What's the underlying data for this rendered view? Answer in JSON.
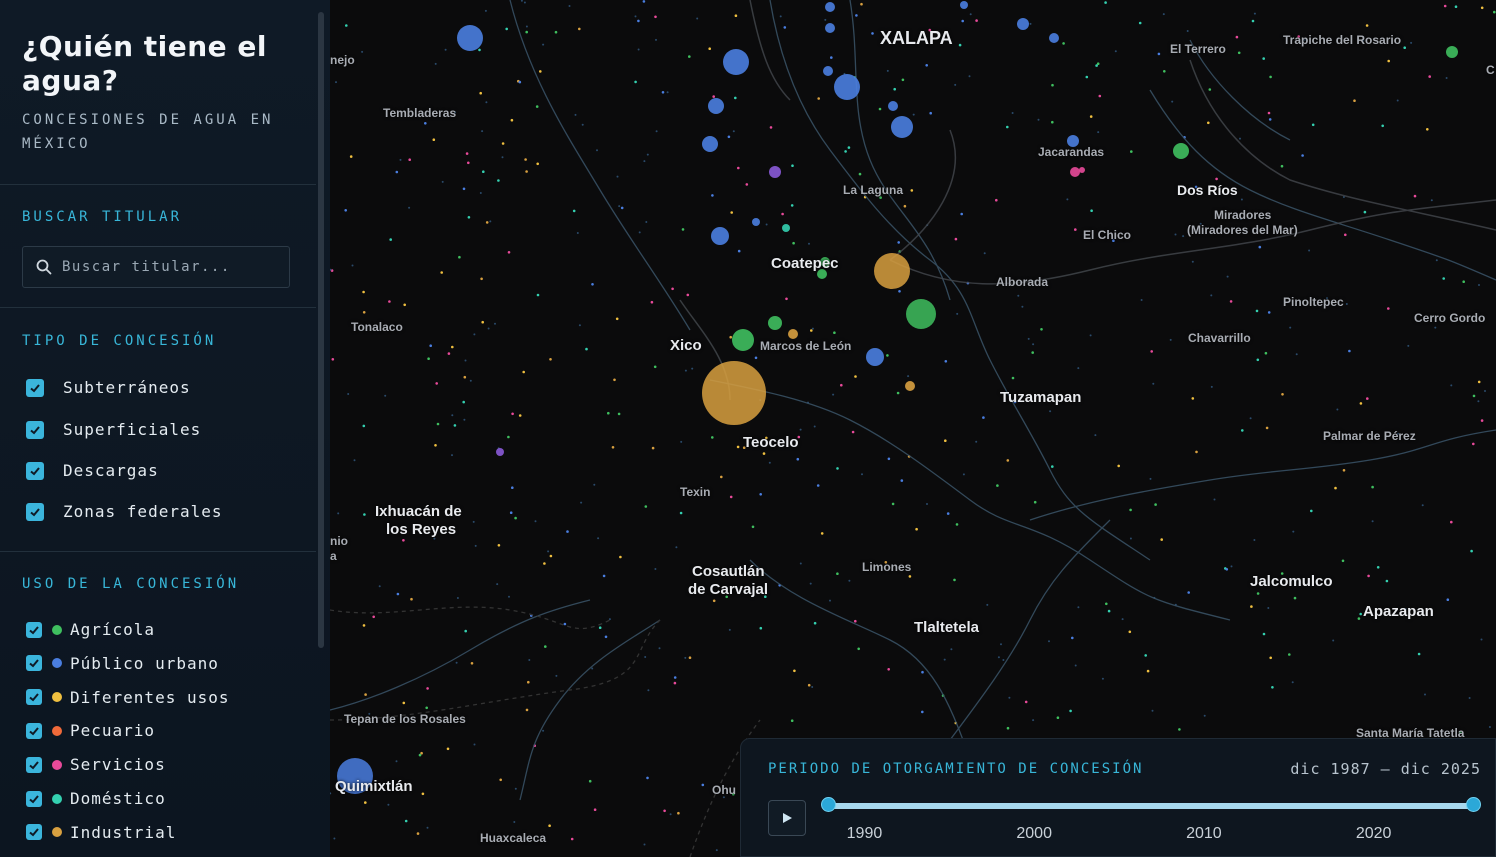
{
  "sidebar": {
    "title": "¿Quién tiene el agua?",
    "subtitle": "CONCESIONES DE AGUA EN MÉXICO",
    "search": {
      "label": "BUSCAR TITULAR",
      "placeholder": "Buscar titular...",
      "icon": "search-icon"
    },
    "tipo": {
      "label": "TIPO DE CONCESIÓN",
      "items": [
        {
          "label": "Subterráneos",
          "checked": true
        },
        {
          "label": "Superficiales",
          "checked": true
        },
        {
          "label": "Descargas",
          "checked": true
        },
        {
          "label": "Zonas federales",
          "checked": true
        }
      ]
    },
    "uso": {
      "label": "USO DE LA CONCESIÓN",
      "items": [
        {
          "label": "Agrícola",
          "color": "#3fbf5f",
          "checked": true
        },
        {
          "label": "Público urbano",
          "color": "#4a7ee0",
          "checked": true
        },
        {
          "label": "Diferentes usos",
          "color": "#f0c040",
          "checked": true
        },
        {
          "label": "Pecuario",
          "color": "#f06a3a",
          "checked": true
        },
        {
          "label": "Servicios",
          "color": "#e84a9a",
          "checked": true
        },
        {
          "label": "Doméstico",
          "color": "#34d0b0",
          "checked": true
        },
        {
          "label": "Industrial",
          "color": "#d8a040",
          "checked": true
        }
      ]
    }
  },
  "map": {
    "places": {
      "xalapa": "XALAPA",
      "el_terrero": "El Terrero",
      "trapiche": "Trapiche del Rosario",
      "nejo": "nejo",
      "tembladeras": "Tembladeras",
      "jacarandas": "Jacarandas",
      "la_laguna": "La Laguna",
      "dos_rios": "Dos Ríos",
      "miradores": "Miradores",
      "miradores_sub": "(Miradores del Mar)",
      "el_chico": "El Chico",
      "coatepec": "Coatepec",
      "alborada": "Alborada",
      "pinoltepec": "Pinoltepec",
      "tonalaco": "Tonalaco",
      "cerro_gordo": "Cerro Gordo",
      "chavarrillo": "Chavarrillo",
      "xico": "Xico",
      "marcos_de_leon": "Marcos de León",
      "tuzamapan": "Tuzamapan",
      "teocelo": "Teocelo",
      "palmar_de_perez": "Palmar de Pérez",
      "texin": "Texin",
      "ixhuacan_1": "Ixhuacán de",
      "ixhuacan_2": "los Reyes",
      "nio_1": "nio",
      "nio_2": "a",
      "cosautlan_1": "Cosautlán",
      "cosautlan_2": "de Carvajal",
      "limones": "Limones",
      "jalcomulco": "Jalcomulco",
      "apazapan": "Apazapan",
      "tlaltetela": "Tlaltetela",
      "tepan": "Tepan de los Rosales",
      "santa_maria": "Santa María Tatetla",
      "quimixtlan": "Quimixtlán",
      "ohu": "Ohu",
      "huaxcaleca": "Huaxcaleca",
      "c_edge": "C"
    },
    "bubbles": [
      {
        "uso": "Público urbano",
        "size": "large"
      },
      {
        "uso": "Diferentes usos",
        "size": "very large"
      },
      {
        "uso": "Agrícola",
        "size": "medium"
      },
      {
        "uso": "Industrial",
        "size": "large"
      }
    ]
  },
  "timeline": {
    "label": "PERIODO DE OTORGAMIENTO DE CONCESIÓN",
    "range": "dic 1987 — dic 2025",
    "start": "1987-12",
    "end": "2025-12",
    "min_year": 1987.9,
    "max_year": 2025.9,
    "ticks": [
      "1990",
      "2000",
      "2010",
      "2020"
    ],
    "play_icon": "play-icon"
  }
}
